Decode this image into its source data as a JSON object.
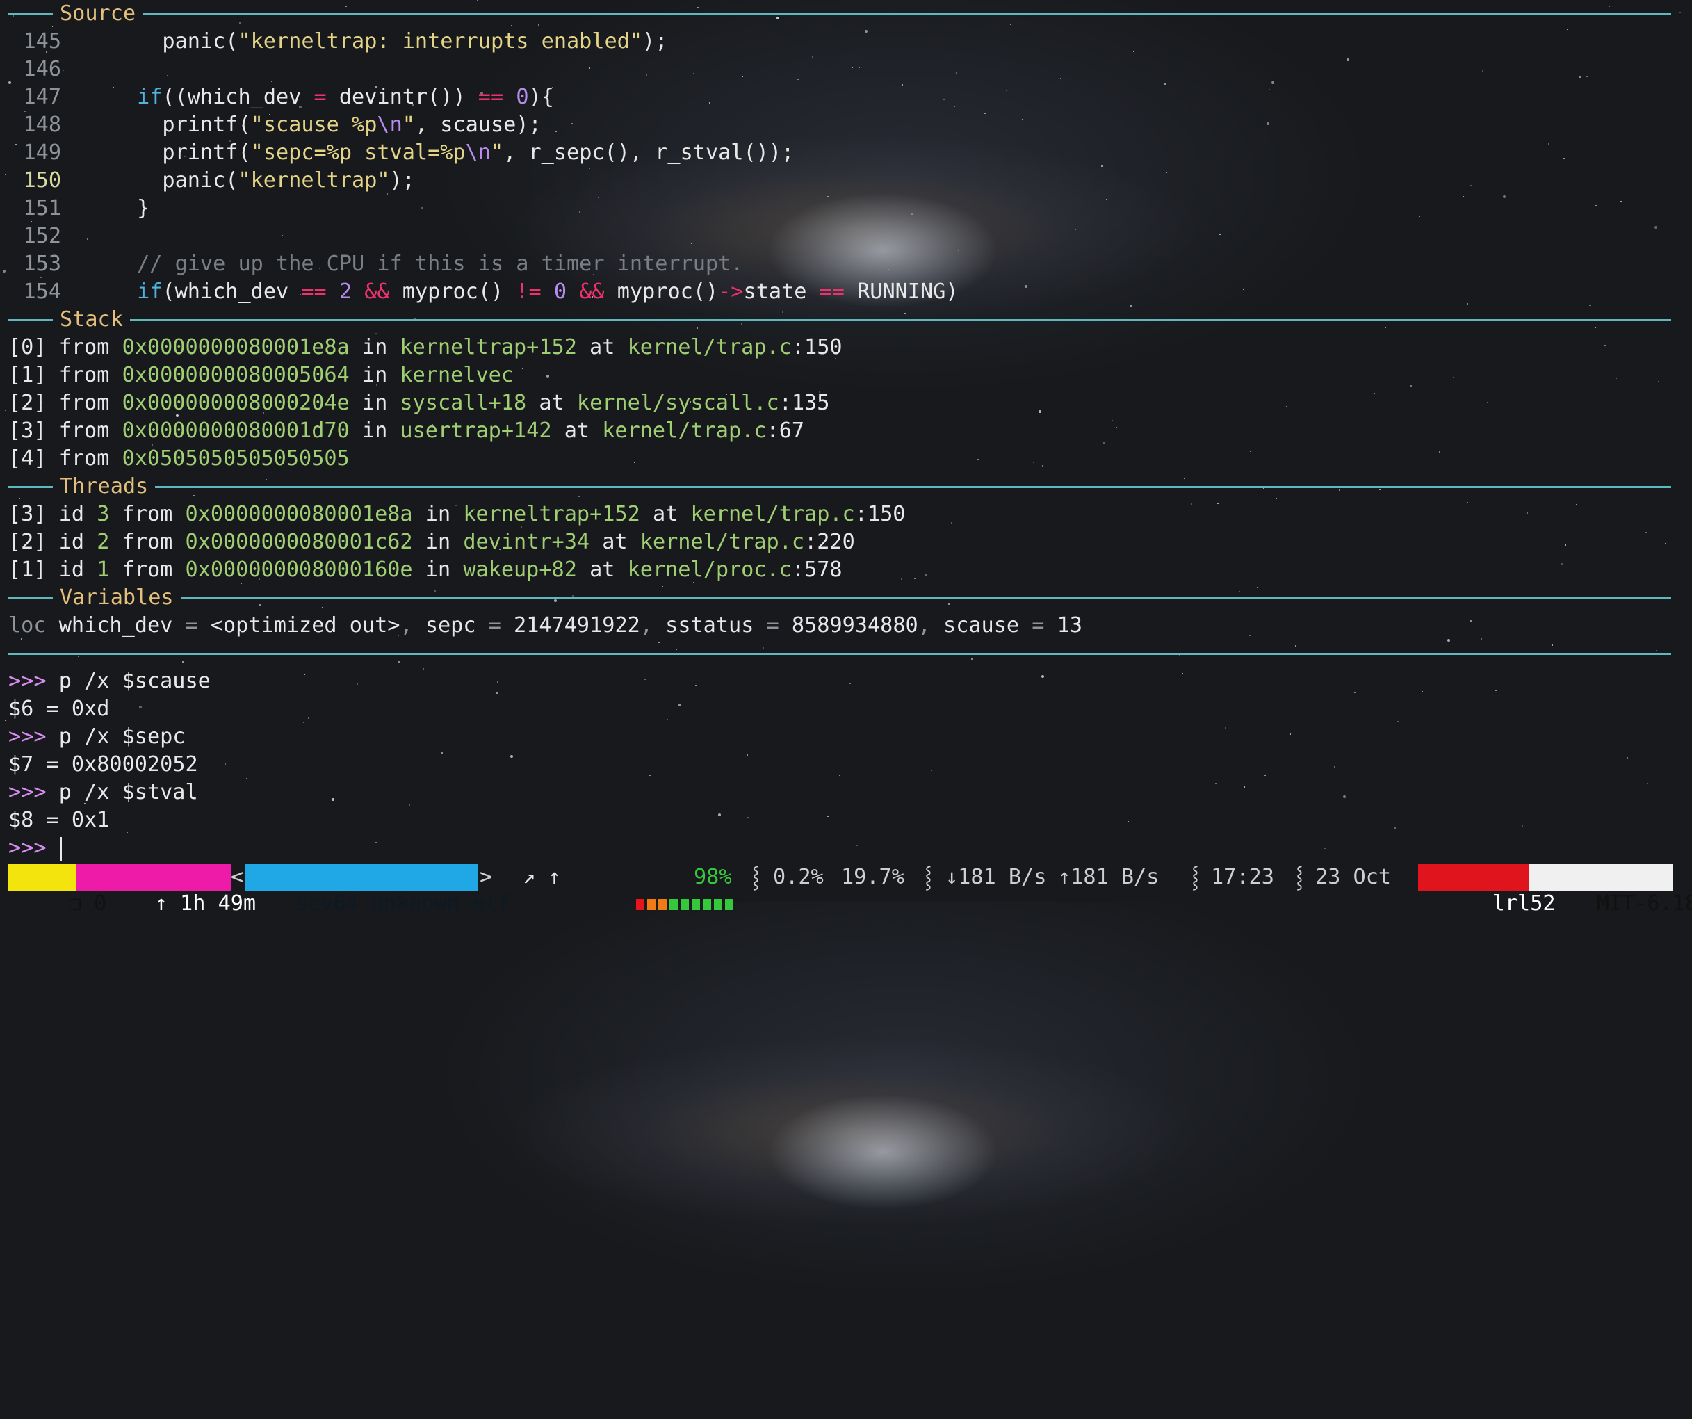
{
  "source": {
    "title": "Source",
    "lines": [
      {
        "no": "145",
        "current": false,
        "tokens": [
          [
            "",
            "      panic("
          ],
          [
            "str",
            "\"kerneltrap: interrupts enabled\""
          ],
          [
            "",
            ");"
          ]
        ]
      },
      {
        "no": "146",
        "current": false,
        "tokens": [
          [
            "",
            ""
          ]
        ]
      },
      {
        "no": "147",
        "current": false,
        "tokens": [
          [
            "",
            "    "
          ],
          [
            "kw",
            "if"
          ],
          [
            "",
            "((which_dev "
          ],
          [
            "op",
            "="
          ],
          [
            "",
            " devintr()) "
          ],
          [
            "op",
            "=="
          ],
          [
            "num",
            " 0"
          ],
          [
            "",
            ")"
          ],
          [
            "",
            "{"
          ]
        ]
      },
      {
        "no": "148",
        "current": false,
        "tokens": [
          [
            "",
            "      printf("
          ],
          [
            "str",
            "\"scause %p"
          ],
          [
            "esc",
            "\\n"
          ],
          [
            "str",
            "\""
          ],
          [
            "",
            ", scause);"
          ]
        ]
      },
      {
        "no": "149",
        "current": false,
        "tokens": [
          [
            "",
            "      printf("
          ],
          [
            "str",
            "\"sepc=%p stval=%p"
          ],
          [
            "esc",
            "\\n"
          ],
          [
            "str",
            "\""
          ],
          [
            "",
            ", r_sepc(), r_stval());"
          ]
        ]
      },
      {
        "no": "150",
        "current": true,
        "tokens": [
          [
            "",
            "      panic("
          ],
          [
            "str",
            "\"kerneltrap\""
          ],
          [
            "",
            ");"
          ]
        ]
      },
      {
        "no": "151",
        "current": false,
        "tokens": [
          [
            "",
            "    }"
          ]
        ]
      },
      {
        "no": "152",
        "current": false,
        "tokens": [
          [
            "",
            ""
          ]
        ]
      },
      {
        "no": "153",
        "current": false,
        "tokens": [
          [
            "",
            "    "
          ],
          [
            "cmt",
            "// give up the CPU if this is a timer interrupt."
          ]
        ]
      },
      {
        "no": "154",
        "current": false,
        "tokens": [
          [
            "",
            "    "
          ],
          [
            "kw",
            "if"
          ],
          [
            "",
            "(which_dev "
          ],
          [
            "op",
            "=="
          ],
          [
            "num",
            " 2"
          ],
          [
            "",
            ""
          ],
          [
            "op",
            " &&"
          ],
          [
            "",
            " myproc() "
          ],
          [
            "op",
            "!="
          ],
          [
            "num",
            " 0"
          ],
          [
            "op",
            " &&"
          ],
          [
            "",
            " myproc()"
          ],
          [
            "op",
            "->"
          ],
          [
            "",
            "state "
          ],
          [
            "op",
            "=="
          ],
          [
            "",
            " RUNNING)"
          ]
        ]
      }
    ]
  },
  "stack": {
    "title": "Stack",
    "frames": [
      {
        "idx": "[0]",
        "addr": "0x0000000080001e8a",
        "func": "kerneltrap",
        "offset": "+152",
        "file": "kernel/trap.c",
        "line": "150"
      },
      {
        "idx": "[1]",
        "addr": "0x0000000080005064",
        "func": "kernelvec",
        "offset": "",
        "file": "",
        "line": ""
      },
      {
        "idx": "[2]",
        "addr": "0x000000008000204e",
        "func": "syscall",
        "offset": "+18",
        "file": "kernel/syscall.c",
        "line": "135"
      },
      {
        "idx": "[3]",
        "addr": "0x0000000080001d70",
        "func": "usertrap",
        "offset": "+142",
        "file": "kernel/trap.c",
        "line": "67"
      },
      {
        "idx": "[4]",
        "addr": "0x0505050505050505",
        "func": "",
        "offset": "",
        "file": "",
        "line": ""
      }
    ]
  },
  "threads": {
    "title": "Threads",
    "items": [
      {
        "idx": "[3]",
        "id": "3",
        "addr": "0x0000000080001e8a",
        "func": "kerneltrap",
        "offset": "+152",
        "file": "kernel/trap.c",
        "line": "150"
      },
      {
        "idx": "[2]",
        "id": "2",
        "addr": "0x0000000080001c62",
        "func": "devintr",
        "offset": "+34",
        "file": "kernel/trap.c",
        "line": "220"
      },
      {
        "idx": "[1]",
        "id": "1",
        "addr": "0x000000008000160e",
        "func": "wakeup",
        "offset": "+82",
        "file": "kernel/proc.c",
        "line": "578"
      }
    ]
  },
  "variables": {
    "title": "Variables",
    "scope": "loc",
    "items": [
      {
        "name": "which_dev",
        "value": "<optimized out>"
      },
      {
        "name": "sepc",
        "value": "2147491922"
      },
      {
        "name": "sstatus",
        "value": "8589934880"
      },
      {
        "name": "scause",
        "value": "13"
      }
    ]
  },
  "console": {
    "prompt": ">>>",
    "lines": [
      {
        "type": "cmd",
        "text": "p /x $scause"
      },
      {
        "type": "out",
        "text": "$6 = 0xd"
      },
      {
        "type": "cmd",
        "text": "p /x $sepc"
      },
      {
        "type": "out",
        "text": "$7 = 0x80002052"
      },
      {
        "type": "cmd",
        "text": "p /x $stval"
      },
      {
        "type": "out",
        "text": "$8 = 0x1"
      },
      {
        "type": "cmd",
        "text": ""
      }
    ]
  },
  "status_bar": {
    "session_icon": "❐",
    "session": "0",
    "uptime": "↑ 1h 49m",
    "target": "scv64-unknown-elf",
    "arrows": "↗ ↑",
    "battery_pct": "98%",
    "battery_level": 0.98,
    "cpu": "0.2%",
    "mem": "19.7%",
    "down": "↓181 B/s",
    "up": "↑181 B/s",
    "time": "17:23",
    "date": "23 Oct",
    "user": "lrl52",
    "host": "MIT-6.1810",
    "colors": {
      "session_bg": "#f2e40c",
      "uptime_bg": "#ee1aa8",
      "target_bg": "#20a8e6",
      "battery_red": "#e8141c",
      "battery_orange": "#f07a14",
      "battery_green": "#36c83c",
      "user_bg": "#e0141c",
      "host_bg": "#f0f0f0"
    }
  }
}
